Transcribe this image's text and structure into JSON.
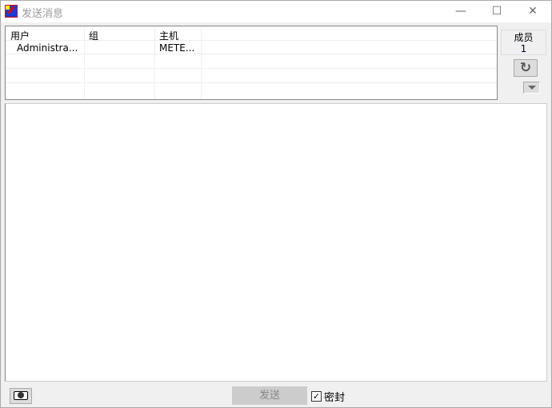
{
  "window": {
    "title": "发送消息",
    "controls": {
      "minimize": "—",
      "maximize": "☐",
      "close": "✕"
    }
  },
  "user_list": {
    "columns": [
      "用户",
      "组",
      "主机"
    ],
    "rows": [
      {
        "user": "Administra...",
        "group": "",
        "host": "METE..."
      }
    ]
  },
  "members": {
    "label": "成员",
    "count": "1"
  },
  "icons": {
    "refresh": "↻"
  },
  "footer": {
    "send_label": "发送",
    "seal_label": "密封",
    "seal_checked": true,
    "check_mark": "✓"
  }
}
